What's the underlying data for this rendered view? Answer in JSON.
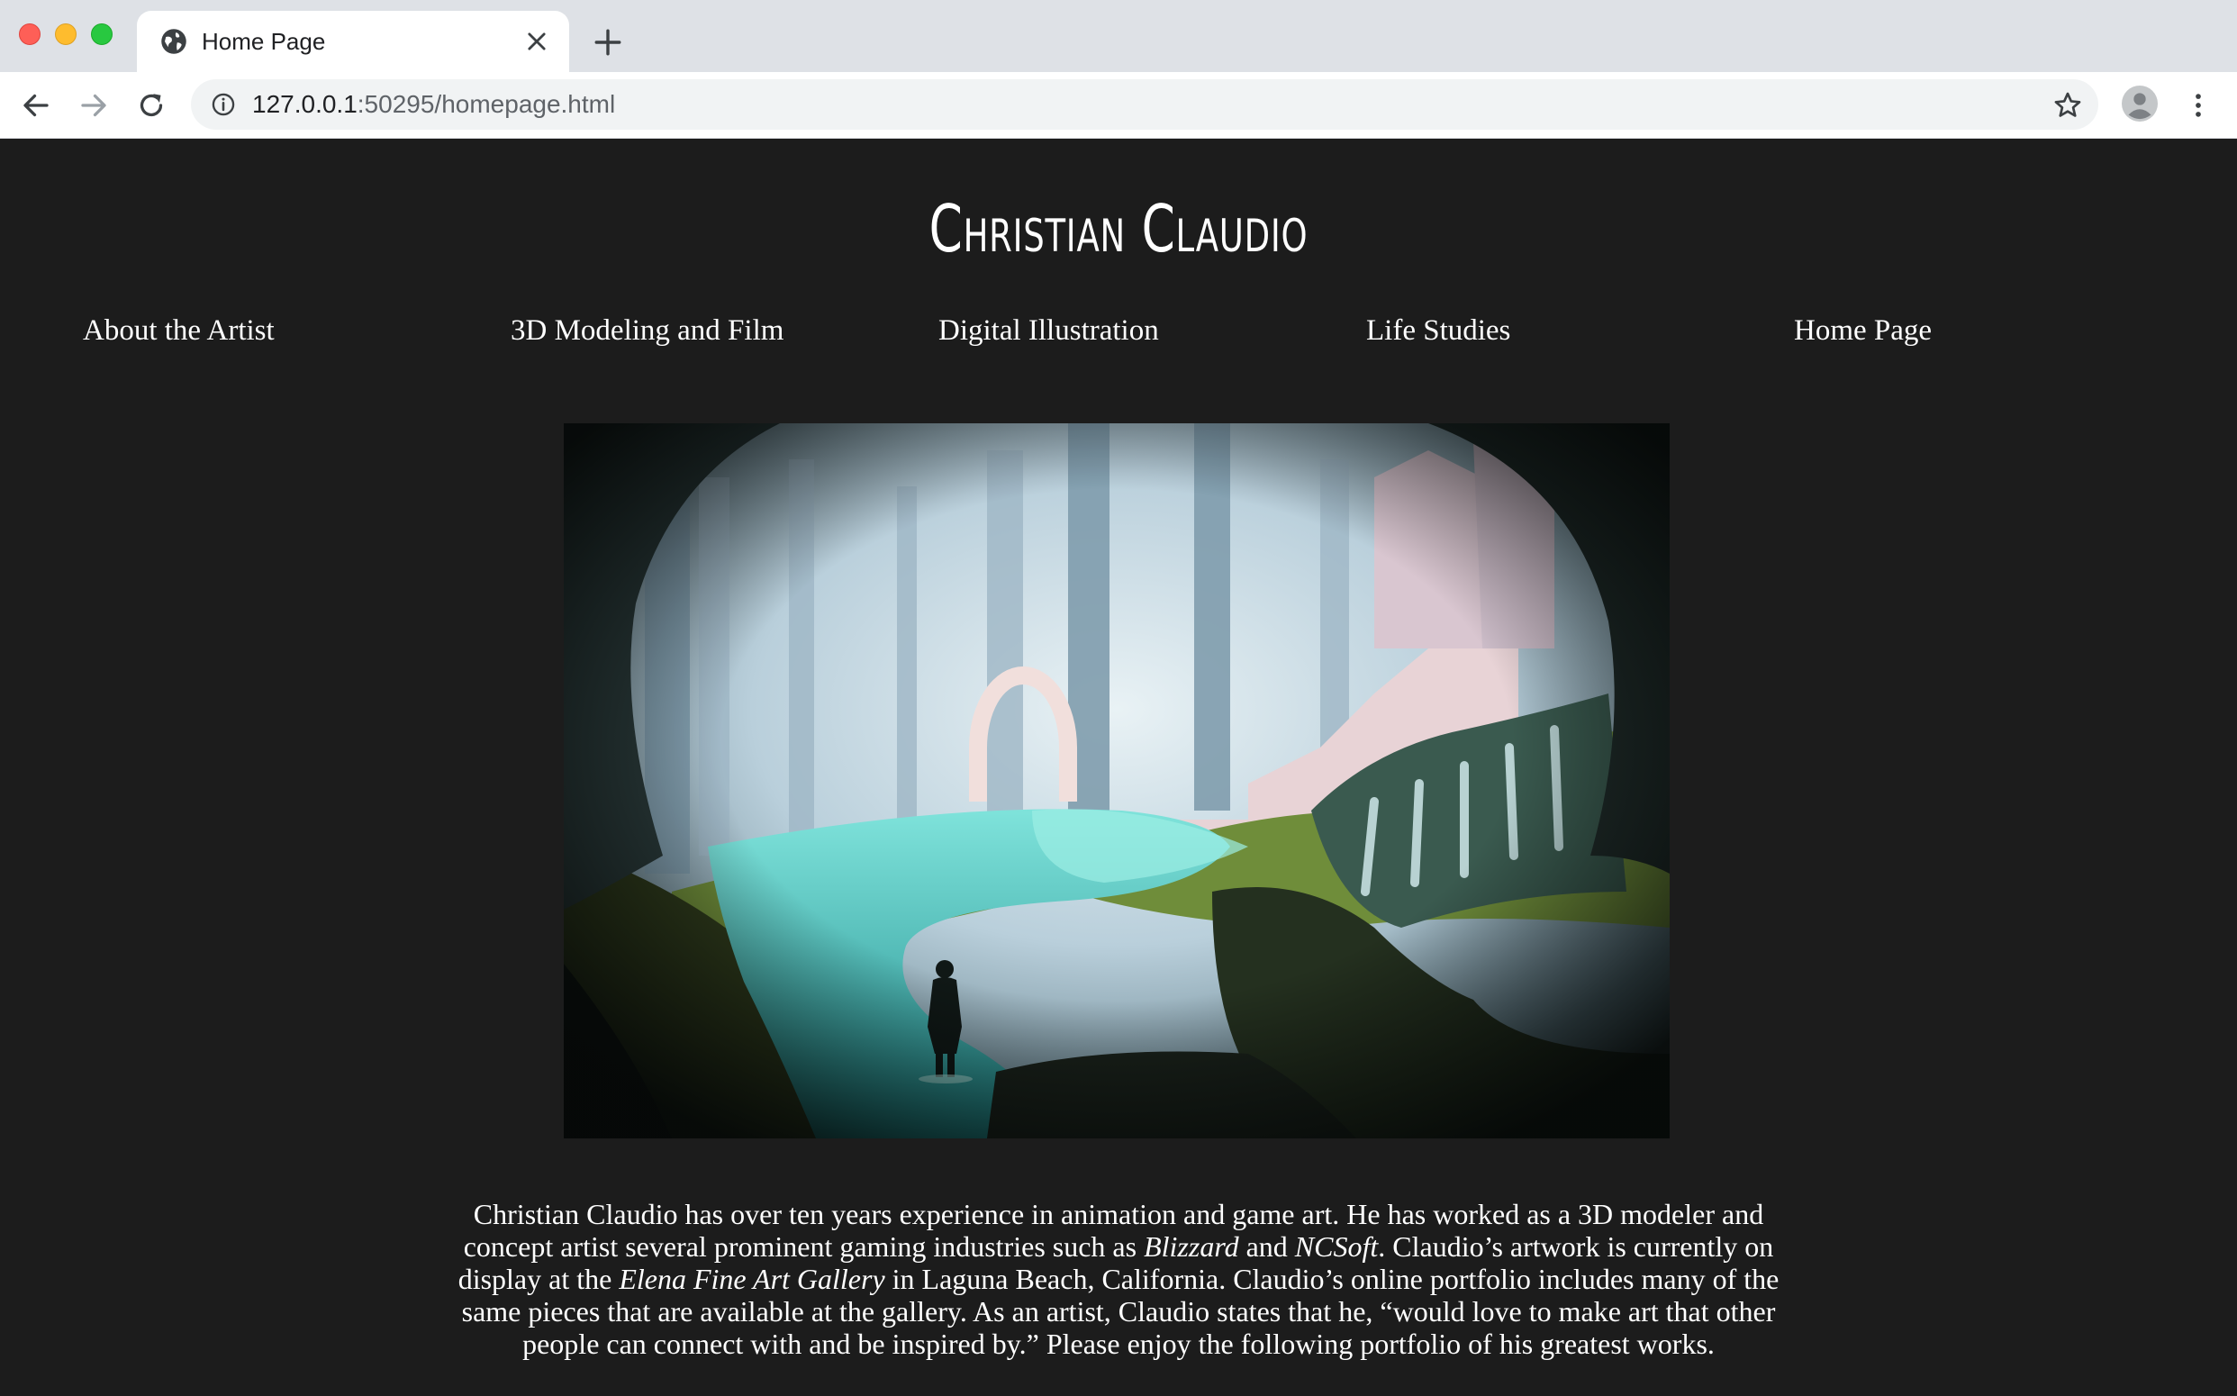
{
  "browser": {
    "tab_title": "Home Page",
    "url_host": "127.0.0.1",
    "url_path": ":50295/homepage.html",
    "icons": {
      "favicon": "globe-icon",
      "close": "close-icon",
      "new_tab": "plus-icon",
      "back": "back-arrow-icon",
      "forward": "forward-arrow-icon",
      "reload": "reload-icon",
      "site_info": "info-icon",
      "bookmark": "star-icon",
      "profile": "avatar-icon",
      "menu": "kebab-menu-icon"
    }
  },
  "site": {
    "title": "Christian Claudio",
    "nav": [
      "About the Artist",
      "3D Modeling and Film",
      "Digital Illustration",
      "Life Studies",
      "Home Page"
    ],
    "hero_image": "painting of a figure standing in a turquoise river flowing through a misty forest with ruins and waterfalls",
    "bio": {
      "p1": "Christian Claudio has over ten years experience in animation and game art. He has worked as a 3D modeler and concept artist several prominent gaming industries such as ",
      "em1": "Blizzard",
      "p2": " and ",
      "em2": "NCSoft",
      "p3": ". Claudio’s artwork is currently on display at the ",
      "em3": "Elena Fine Art Gallery",
      "p4": " in Laguna Beach, California. Claudio’s online portfolio includes many of the same pieces that are available at the gallery. As an artist, Claudio states that he, “would love to make art that other people can connect with and be inspired by.” Please enjoy the following portfolio of his greatest works."
    }
  },
  "colors": {
    "page_bg": "#1c1c1c",
    "text": "#ffffff",
    "chrome_bg": "#dee1e6"
  }
}
